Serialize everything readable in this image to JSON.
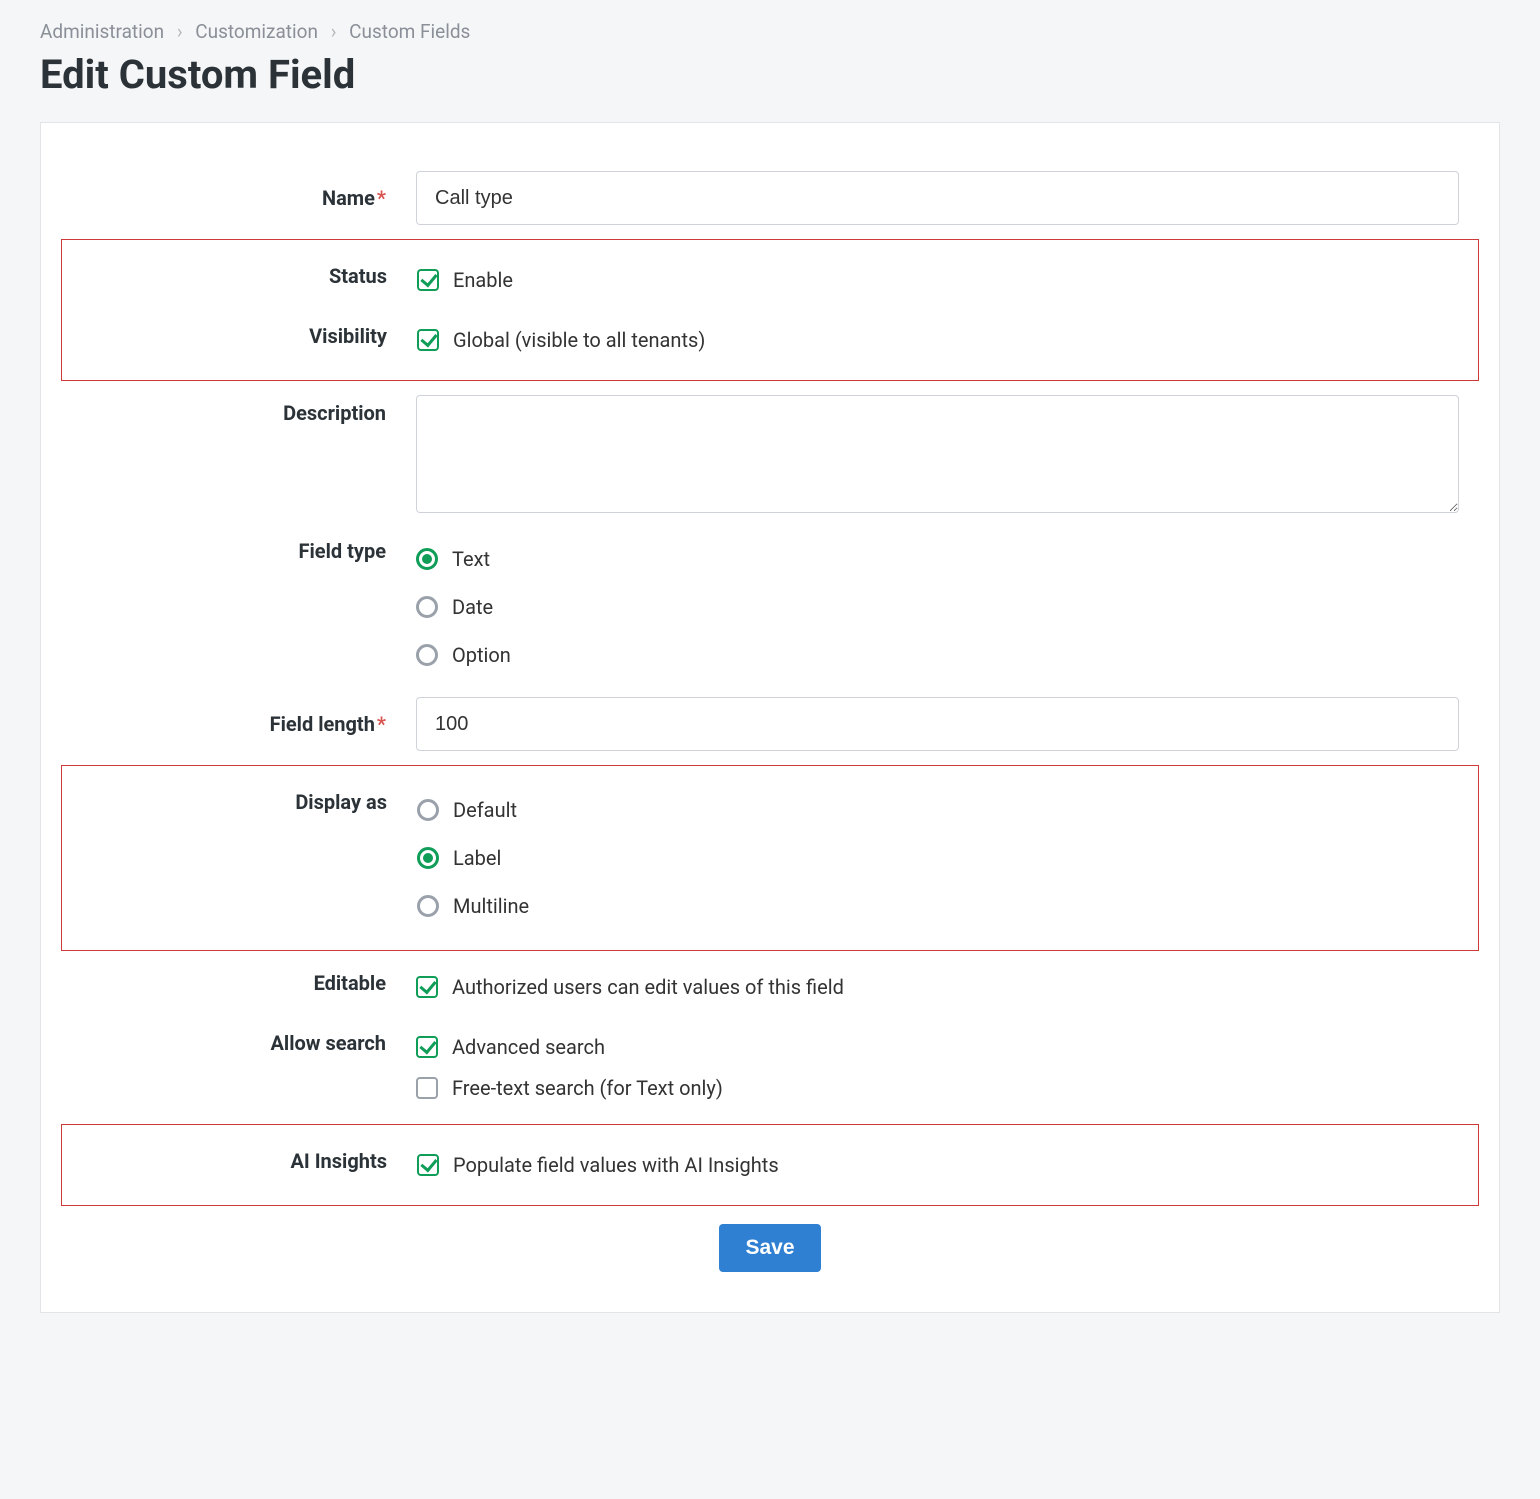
{
  "breadcrumb": {
    "items": [
      "Administration",
      "Customization",
      "Custom Fields"
    ]
  },
  "page_title": "Edit Custom Field",
  "labels": {
    "name": "Name",
    "status": "Status",
    "visibility": "Visibility",
    "description": "Description",
    "field_type": "Field type",
    "field_length": "Field length",
    "display_as": "Display as",
    "editable": "Editable",
    "allow_search": "Allow search",
    "ai_insights": "AI Insights"
  },
  "values": {
    "name": "Call type",
    "field_length": "100",
    "description": ""
  },
  "options": {
    "status_enable": "Enable",
    "visibility_global": "Global (visible to all tenants)",
    "field_type": {
      "text": "Text",
      "date": "Date",
      "option": "Option"
    },
    "display_as": {
      "default": "Default",
      "label": "Label",
      "multiline": "Multiline"
    },
    "editable_authorized": "Authorized users can edit values of this field",
    "allow_search_advanced": "Advanced search",
    "allow_search_freetext": "Free-text search (for Text only)",
    "ai_insights_populate": "Populate field values with AI Insights"
  },
  "state": {
    "status_enable": true,
    "visibility_global": true,
    "field_type_selected": "text",
    "display_as_selected": "label",
    "editable_authorized": true,
    "allow_search_advanced": true,
    "allow_search_freetext": false,
    "ai_insights_populate": true
  },
  "buttons": {
    "save": "Save"
  }
}
